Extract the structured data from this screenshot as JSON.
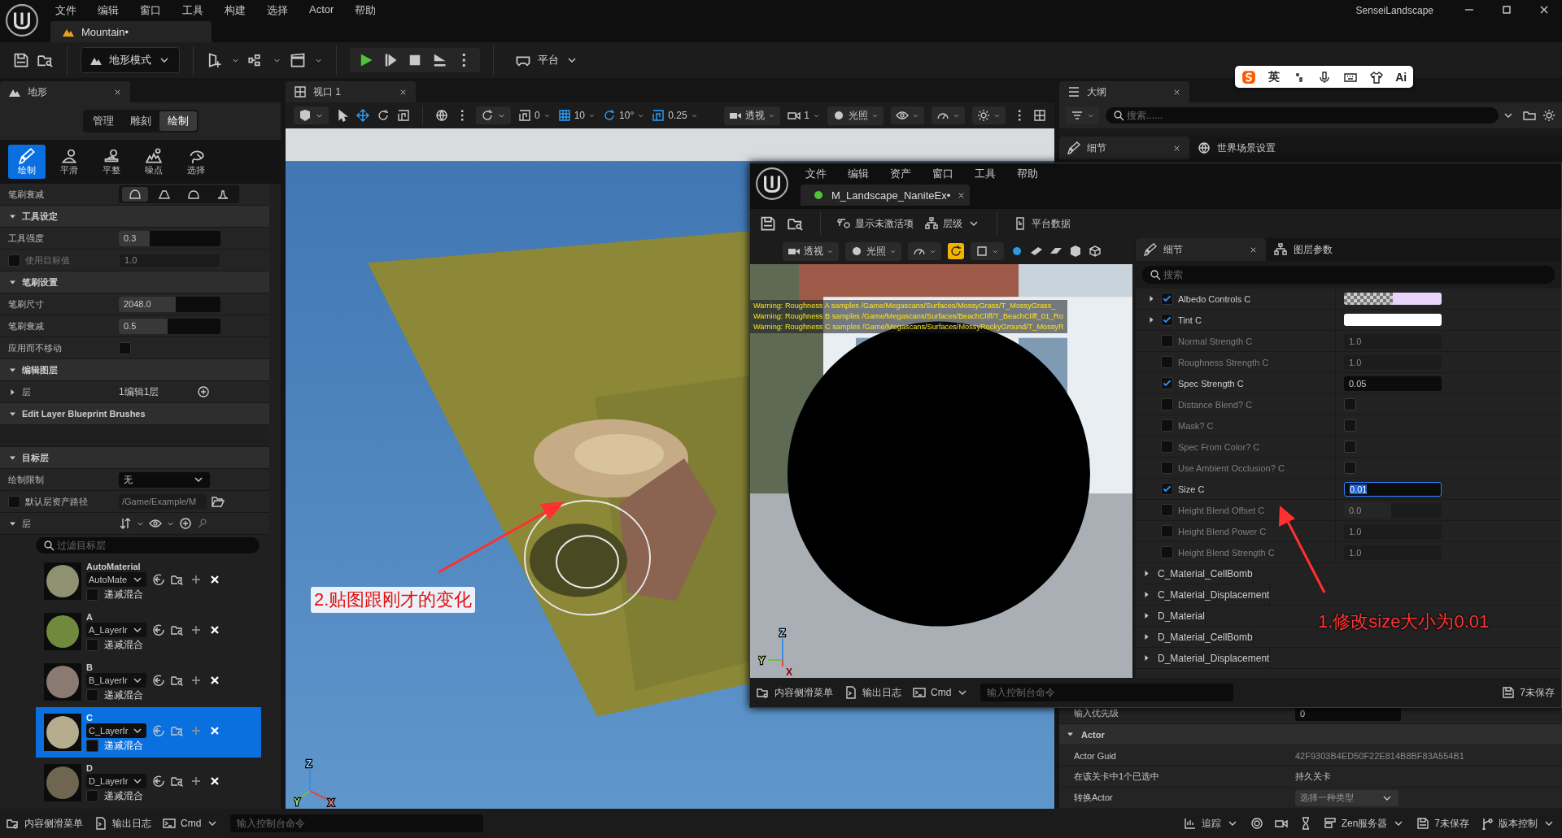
{
  "app_menu": [
    "文件",
    "编辑",
    "窗口",
    "工具",
    "构建",
    "选择",
    "Actor",
    "帮助"
  ],
  "level_tab": "Mountain•",
  "project_name": "SenseiLandscape",
  "toolbar": {
    "mode": "地形模式",
    "platform": "平台"
  },
  "ime_bar": [
    {
      "kind": "logo"
    },
    {
      "kind": "text",
      "label": "英"
    },
    {
      "kind": "punct"
    },
    {
      "kind": "mic"
    },
    {
      "kind": "keyboard"
    },
    {
      "kind": "skin"
    },
    {
      "kind": "text",
      "label": "Ai"
    }
  ],
  "landscape": {
    "title": "地形",
    "modes": [
      {
        "label": "管理",
        "selected": false
      },
      {
        "label": "雕刻",
        "selected": false
      },
      {
        "label": "绘制",
        "selected": true
      }
    ],
    "tools": [
      {
        "kind": "paint",
        "label": "绘制",
        "selected": true
      },
      {
        "kind": "smooth",
        "label": "平滑",
        "selected": false
      },
      {
        "kind": "flatten",
        "label": "平整",
        "selected": false
      },
      {
        "kind": "noise",
        "label": "噪点",
        "selected": false
      },
      {
        "kind": "select",
        "label": "选择",
        "selected": false
      }
    ],
    "falloff": {
      "label": "笔刷衰减",
      "options": [
        {
          "kind": "smooth",
          "selected": true
        },
        {
          "kind": "linear",
          "selected": false
        },
        {
          "kind": "spherical",
          "selected": false
        },
        {
          "kind": "tip",
          "selected": false
        }
      ]
    },
    "rows": [
      {
        "kind": "section",
        "label": "工具设定",
        "expanded": true
      },
      {
        "kind": "slider",
        "label": "工具强度",
        "value": "0.3",
        "level": 0.3
      },
      {
        "kind": "check_value",
        "label": "使用目标值",
        "checked": false,
        "value": "1.0"
      },
      {
        "kind": "section",
        "label": "笔刷设置",
        "expanded": true
      },
      {
        "kind": "slider",
        "label": "笔刷尺寸",
        "value": "2048.0",
        "level": 0.56
      },
      {
        "kind": "slider",
        "label": "笔刷衰减",
        "value": "0.5",
        "level": 0.48
      },
      {
        "kind": "checkbox",
        "label": "应用而不移动",
        "checked": false
      },
      {
        "kind": "section",
        "label": "编辑图层",
        "expanded": true
      },
      {
        "kind": "group",
        "label": "层",
        "value": "1编辑1层",
        "expanded": false
      },
      {
        "kind": "section",
        "label": "Edit Layer Blueprint Brushes",
        "expanded": true
      },
      {
        "kind": "blank"
      },
      {
        "kind": "section",
        "label": "目标层",
        "expanded": true
      },
      {
        "kind": "dropdown",
        "label": "绘制限制",
        "value": "无"
      },
      {
        "kind": "path",
        "label": "默认层资产路径",
        "checked": false,
        "value": "/Game/Example/M"
      },
      {
        "kind": "layers_header",
        "label": "层",
        "expanded": true
      }
    ],
    "layer_filter_placeholder": "过滤目标层",
    "layers": [
      {
        "name": "AutoMaterial",
        "asset": "AutoMate",
        "color": "#8e9270",
        "blend_label": "递减混合",
        "blend_checked": false,
        "selected": false
      },
      {
        "name": "A",
        "asset": "A_LayerIr",
        "color": "#6f8a3c",
        "blend_label": "递减混合",
        "blend_checked": false,
        "selected": false
      },
      {
        "name": "B",
        "asset": "B_LayerIr",
        "color": "#8a7a72",
        "blend_label": "递减混合",
        "blend_checked": false,
        "selected": false
      },
      {
        "name": "C",
        "asset": "C_LayerIr",
        "color": "#b6ad8e",
        "blend_label": "递减混合",
        "blend_checked": false,
        "selected": true
      },
      {
        "name": "D",
        "asset": "D_LayerIr",
        "color": "#6e6650",
        "blend_label": "递减混合",
        "blend_checked": false,
        "selected": false
      }
    ]
  },
  "viewport": {
    "tab": "视口 1",
    "snaps": [
      {
        "kind": "surface",
        "value": "0",
        "on": false
      },
      {
        "kind": "grid",
        "value": "10",
        "on": true
      },
      {
        "kind": "rotate",
        "value": "10°",
        "on": true
      },
      {
        "kind": "scale",
        "value": "0.25",
        "on": true
      }
    ],
    "view_mode": "透视",
    "camera_speed": "1",
    "lighting": "光照",
    "axis_labels": [
      "Z",
      "Y",
      "X"
    ]
  },
  "outliner": {
    "title": "大纲",
    "search_placeholder": "搜索......"
  },
  "details_tabs": [
    {
      "label": "细节",
      "selected": true
    },
    {
      "label": "世界场景设置",
      "selected": false
    }
  ],
  "details_rows": [
    {
      "kind": "field",
      "label": "输入优先级",
      "value": "0"
    },
    {
      "kind": "section",
      "label": "Actor",
      "expanded": true
    },
    {
      "kind": "text",
      "label": "Actor Guid",
      "value": "42F9303B4ED50F22E814B8BF83A554B1",
      "disabled": true
    },
    {
      "kind": "text",
      "label": "在该关卡中1个已选中",
      "value": "持久关卡",
      "disabled": false
    },
    {
      "kind": "dropdown",
      "label": "转换Actor",
      "value": "选择一种类型"
    }
  ],
  "material_editor": {
    "menu": [
      "文件",
      "编辑",
      "资产",
      "窗口",
      "工具",
      "帮助"
    ],
    "tab": "M_Landscape_NaniteEx•",
    "toolbar": [
      {
        "kind": "inactive",
        "label": "显示未激活项"
      },
      {
        "kind": "hierarchy",
        "label": "层级"
      },
      {
        "kind": "platform",
        "label": "平台数据"
      }
    ],
    "viewport": {
      "view_mode": "透视",
      "lighting": "光照",
      "realtime": true,
      "warnings": [
        "Warning: Roughness A samples /Game/Megascans/Surfaces/MossyGrass/T_MossyGrass_",
        "Warning: Roughness B samples /Game/Megascans/Surfaces/BeachCliff/T_BeachCliff_01_Ro",
        "Warning: Roughness C samples /Game/Megascans/Surfaces/MossyRockyGround/T_MossyR"
      ],
      "axis_labels": [
        "Z",
        "Y",
        "X"
      ]
    },
    "tabs": [
      {
        "label": "细节",
        "selected": true
      },
      {
        "label": "图层参数",
        "selected": false
      }
    ],
    "search_placeholder": "搜索",
    "params": [
      {
        "kind": "color",
        "label": "Albedo Controls C",
        "checked": true,
        "color": "#e8d4fb",
        "checker": true,
        "editing": false
      },
      {
        "kind": "color",
        "label": "Tint C",
        "checked": true,
        "color": "#ffffff",
        "checker": false,
        "editing": false
      },
      {
        "kind": "scalar",
        "label": "Normal Strength C",
        "checked": false,
        "value": "1.0",
        "editing": false
      },
      {
        "kind": "scalar",
        "label": "Roughness Strength C",
        "checked": false,
        "value": "1.0",
        "editing": false
      },
      {
        "kind": "scalar",
        "label": "Spec Strength C",
        "checked": true,
        "value": "0.05",
        "editing": false
      },
      {
        "kind": "bool",
        "label": "Distance Blend? C",
        "checked": false,
        "value_checked": false,
        "editing": false
      },
      {
        "kind": "bool",
        "label": "Mask? C",
        "checked": false,
        "value_checked": false,
        "editing": false
      },
      {
        "kind": "bool",
        "label": "Spec From Color? C",
        "checked": false,
        "value_checked": false,
        "editing": false
      },
      {
        "kind": "bool",
        "label": "Use Ambient Occlusion? C",
        "checked": false,
        "value_checked": false,
        "editing": false
      },
      {
        "kind": "scalar",
        "label": "Size C",
        "checked": true,
        "value": "0.01",
        "editing": true
      },
      {
        "kind": "scalar",
        "label": "Height Blend Offset C",
        "checked": false,
        "value": "0.0",
        "level": 0.48,
        "editing": false
      },
      {
        "kind": "scalar",
        "label": "Height Blend Power C",
        "checked": false,
        "value": "1.0",
        "editing": false
      },
      {
        "kind": "scalar",
        "label": "Height Blend Strength C",
        "checked": false,
        "value": "1.0",
        "editing": false
      }
    ],
    "groups": [
      {
        "label": "C_Material_CellBomb",
        "expanded": false
      },
      {
        "label": "C_Material_Displacement",
        "expanded": false
      },
      {
        "label": "D_Material",
        "expanded": false
      },
      {
        "label": "D_Material_CellBomb",
        "expanded": false
      },
      {
        "label": "D_Material_Displacement",
        "expanded": false
      }
    ],
    "status": {
      "content_drawer": "内容侧滑菜单",
      "output_log": "输出日志",
      "cmd": "Cmd",
      "console_placeholder": "输入控制台命令",
      "unsaved": "7未保存"
    }
  },
  "status_bar": {
    "content_drawer": "内容侧滑菜单",
    "output_log": "输出日志",
    "cmd": "Cmd",
    "console_placeholder": "输入控制台命令",
    "trace": "追踪",
    "zen": "Zen服务器",
    "unsaved": "7未保存",
    "source_control": "版本控制"
  },
  "annotations": [
    {
      "text": "2.贴图跟刚才的变化"
    },
    {
      "text": "1.修改size大小为0.01"
    }
  ]
}
